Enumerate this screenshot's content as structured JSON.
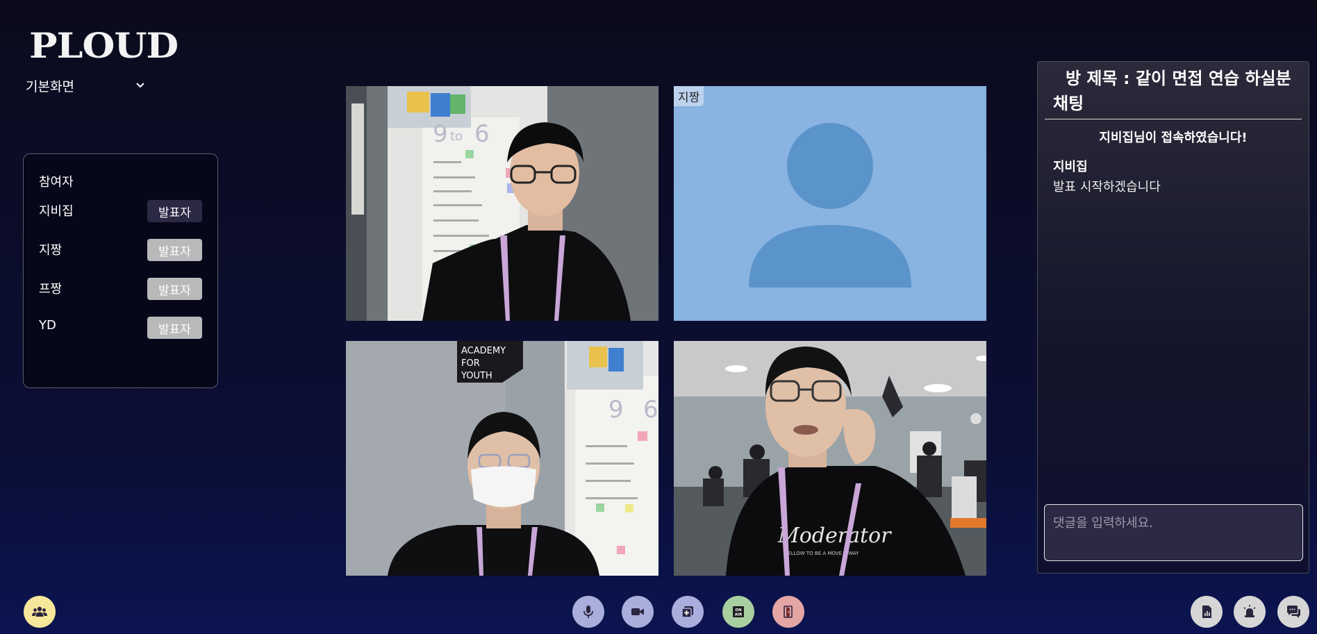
{
  "app": {
    "logo": "PLOUD"
  },
  "view_select": {
    "value": "기본화면"
  },
  "participants": {
    "title": "참여자",
    "items": [
      {
        "name": "지비집",
        "button": "발표자",
        "active": true
      },
      {
        "name": "지짱",
        "button": "발표자",
        "active": false
      },
      {
        "name": "프짱",
        "button": "발표자",
        "active": false
      },
      {
        "name": "YD",
        "button": "발표자",
        "active": false
      }
    ]
  },
  "videos": [
    {
      "tile": "video-1",
      "label": ""
    },
    {
      "tile": "video-2",
      "label": "지짱"
    },
    {
      "tile": "video-3",
      "label": ""
    },
    {
      "tile": "video-4",
      "label": ""
    }
  ],
  "chat": {
    "title": "방 제목 : 같이 면접 연습 하실분 채팅",
    "system_message": "지비집님이 접속하였습니다!",
    "messages": [
      {
        "author": "지비집",
        "text": "발표 시작하겠습니다"
      }
    ],
    "input_placeholder": "댓글을 입력하세요."
  },
  "controls": {
    "left": [
      {
        "icon": "users-icon",
        "color": "#f6e79a"
      }
    ],
    "center": [
      {
        "icon": "microphone-icon",
        "color": "#a9aedc"
      },
      {
        "icon": "video-camera-icon",
        "color": "#a9aedc"
      },
      {
        "icon": "add-screen-icon",
        "color": "#a9aedc"
      },
      {
        "icon": "on-air-icon",
        "color": "#a8cfa0",
        "text": "ON AIR"
      },
      {
        "icon": "exit-door-icon",
        "color": "#e4a5a5"
      }
    ],
    "right": [
      {
        "icon": "report-chart-icon",
        "color": "#d6d6d6"
      },
      {
        "icon": "alarm-siren-icon",
        "color": "#d6d6d6"
      },
      {
        "icon": "chat-bubbles-icon",
        "color": "#d6d6d6"
      }
    ]
  }
}
